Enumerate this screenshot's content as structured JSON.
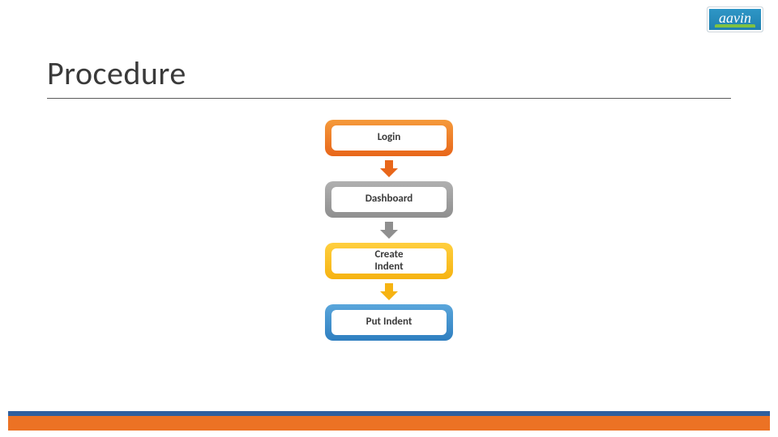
{
  "logo": {
    "text": "aavin"
  },
  "title": "Procedure",
  "flow": {
    "steps": [
      {
        "label": "Login",
        "color": "orange"
      },
      {
        "label": "Dashboard",
        "color": "gray"
      },
      {
        "label": "Create\nIndent",
        "color": "gold"
      },
      {
        "label": "Put Indent",
        "color": "blue"
      }
    ],
    "arrows": [
      "orange",
      "gray",
      "gold"
    ]
  },
  "colors": {
    "orange": "#e8661a",
    "gray": "#8f8f8f",
    "gold": "#f6b312",
    "blue": "#2f7fc0",
    "footer_blue": "#2f5f9e",
    "footer_orange": "#ec7224"
  }
}
